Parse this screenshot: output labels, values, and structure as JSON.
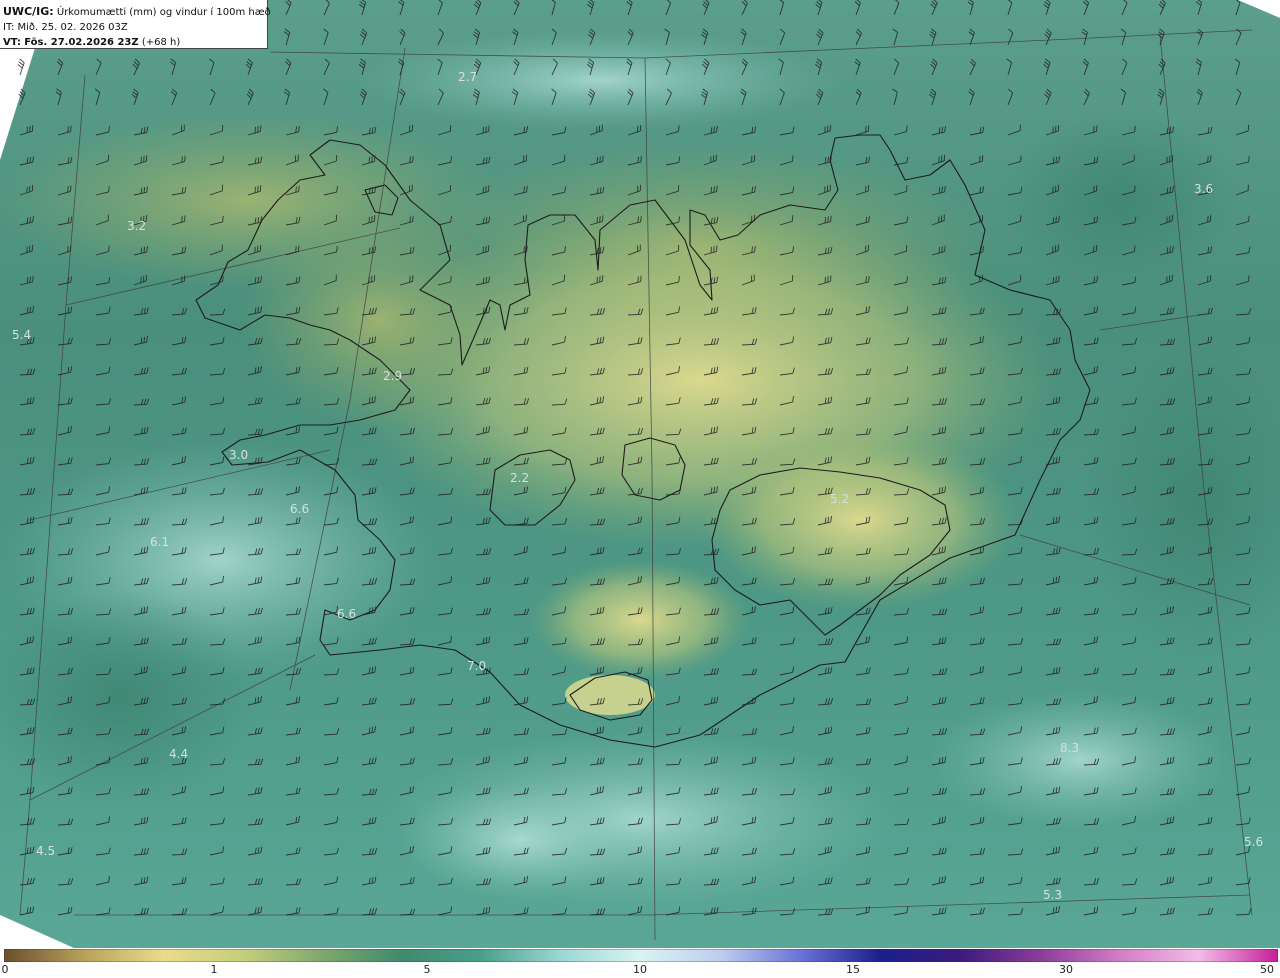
{
  "header": {
    "model_code": "UWC/IG:",
    "title_text": "Úrkomumætti (mm) og vindur í 100m hæð",
    "init_time": "IT: Mið. 25. 02. 2026 03Z",
    "valid_prefix": "VT:",
    "valid_time": "Fös. 27.02.2026 23Z",
    "lead_time": "(+68 h)"
  },
  "map": {
    "coastline_color": "#1c1c1c",
    "grid_color": "#404040",
    "labels": [
      {
        "id": "west-upper",
        "text": "3.2"
      },
      {
        "id": "west-edge",
        "text": "5.4"
      },
      {
        "id": "snaefells",
        "text": "3.0"
      },
      {
        "id": "reykjanes-west",
        "text": "6.6"
      },
      {
        "id": "southwest-far",
        "text": "6.1"
      },
      {
        "id": "reykjanes-south",
        "text": "6.6"
      },
      {
        "id": "south-sea",
        "text": "4.4"
      },
      {
        "id": "south-sea-far",
        "text": "4.5"
      },
      {
        "id": "east-sea",
        "text": "3.6"
      },
      {
        "id": "southeast-sea",
        "text": "5.6"
      },
      {
        "id": "southeast-deep",
        "text": "5.3"
      },
      {
        "id": "westfjords",
        "text": "2.9"
      },
      {
        "id": "langjokull",
        "text": "2.2"
      },
      {
        "id": "north-sea",
        "text": "2.7"
      },
      {
        "id": "south-coast",
        "text": "7.0"
      },
      {
        "id": "vatnajokull",
        "text": "5.2"
      },
      {
        "id": "east-sea-south",
        "text": "8.3"
      }
    ]
  },
  "colorbar": {
    "ticks": [
      "0",
      "1",
      "5",
      "10",
      "15",
      "30",
      "50"
    ],
    "colors": [
      "#6a4e2e",
      "#b8a25a",
      "#eadb8a",
      "#c4cf7a",
      "#7ea86c",
      "#3f8a6e",
      "#4aa08c",
      "#9cd8d4",
      "#d8f4f2",
      "#bccdf0",
      "#6a74d6",
      "#1a1f8c",
      "#3a1b7c",
      "#8a3c9a",
      "#d27cc6",
      "#f2bce8",
      "#c41e9a"
    ]
  }
}
